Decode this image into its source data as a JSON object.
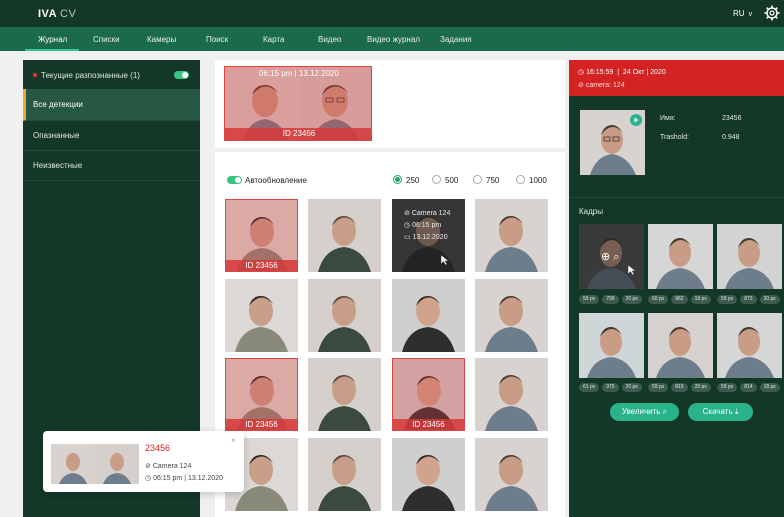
{
  "app": {
    "logo": "IVA",
    "logo_suffix": "CV",
    "lang": "RU",
    "lang_chevron": "v",
    "gear_icon": "gear-icon"
  },
  "nav": {
    "tabs": [
      {
        "label": "Журнал",
        "active": true
      },
      {
        "label": "Списки"
      },
      {
        "label": "Камеры"
      },
      {
        "label": "Поиск"
      },
      {
        "label": "Карта"
      },
      {
        "label": "Видео"
      },
      {
        "label": "Видео журнал"
      },
      {
        "label": "Задания"
      }
    ]
  },
  "sidebar": {
    "items": [
      {
        "label": "Текущие разпознанные (1)"
      },
      {
        "label": "Все детекции"
      },
      {
        "label": "Опазнанные"
      },
      {
        "label": "Неизвестные"
      }
    ]
  },
  "featured": {
    "timestamp": "06:15 pm  |  13.12.2020",
    "id": "ID 23456"
  },
  "controls": {
    "autoupdate_label": "Автообновление",
    "radio_options": [
      "250",
      "500",
      "750",
      "1000"
    ],
    "radio_selected": "250"
  },
  "grid": {
    "tiles": [
      {
        "id": "ID 23456",
        "selected": true
      },
      {},
      {
        "info": true,
        "camera": "Camera 124",
        "time": "06:15 pm",
        "date": "13.12.2020"
      },
      {},
      {},
      {},
      {},
      {},
      {
        "id": "ID 23456",
        "selected": true
      },
      {},
      {
        "id": "ID 23456",
        "selected": true
      },
      {},
      {},
      {},
      {},
      {}
    ]
  },
  "right_panel": {
    "time": "16:15:59",
    "date": "24 Окт  |  2020",
    "camera": "camera:  124",
    "name_label": "Имя:",
    "name_value": "23456",
    "threshold_label": "Trashold:",
    "threshold_value": "0.948",
    "frames_label": "Кадры",
    "frame_pills": [
      [
        "59 px",
        "799",
        "20 px"
      ],
      [
        "60 px",
        "962",
        "19 px"
      ],
      [
        "59 px",
        "873",
        "20 px"
      ],
      [
        "61 px",
        "975",
        "20 px"
      ],
      [
        "59 px",
        "815",
        "20 px"
      ],
      [
        "59 px",
        "814",
        "18 px"
      ]
    ],
    "zoom_button": "Увеличить",
    "download_button": "Скачать"
  },
  "popup": {
    "id": "23456",
    "camera": "Camera 124",
    "timestamp": "06:15 pm  |  13.12.2020",
    "close": "×"
  },
  "colors": {
    "header_dark": "#133827",
    "nav_green": "#1b6b4a",
    "accent": "#31c39a",
    "alert_red": "#d32323",
    "active_marker": "#f2a636"
  }
}
